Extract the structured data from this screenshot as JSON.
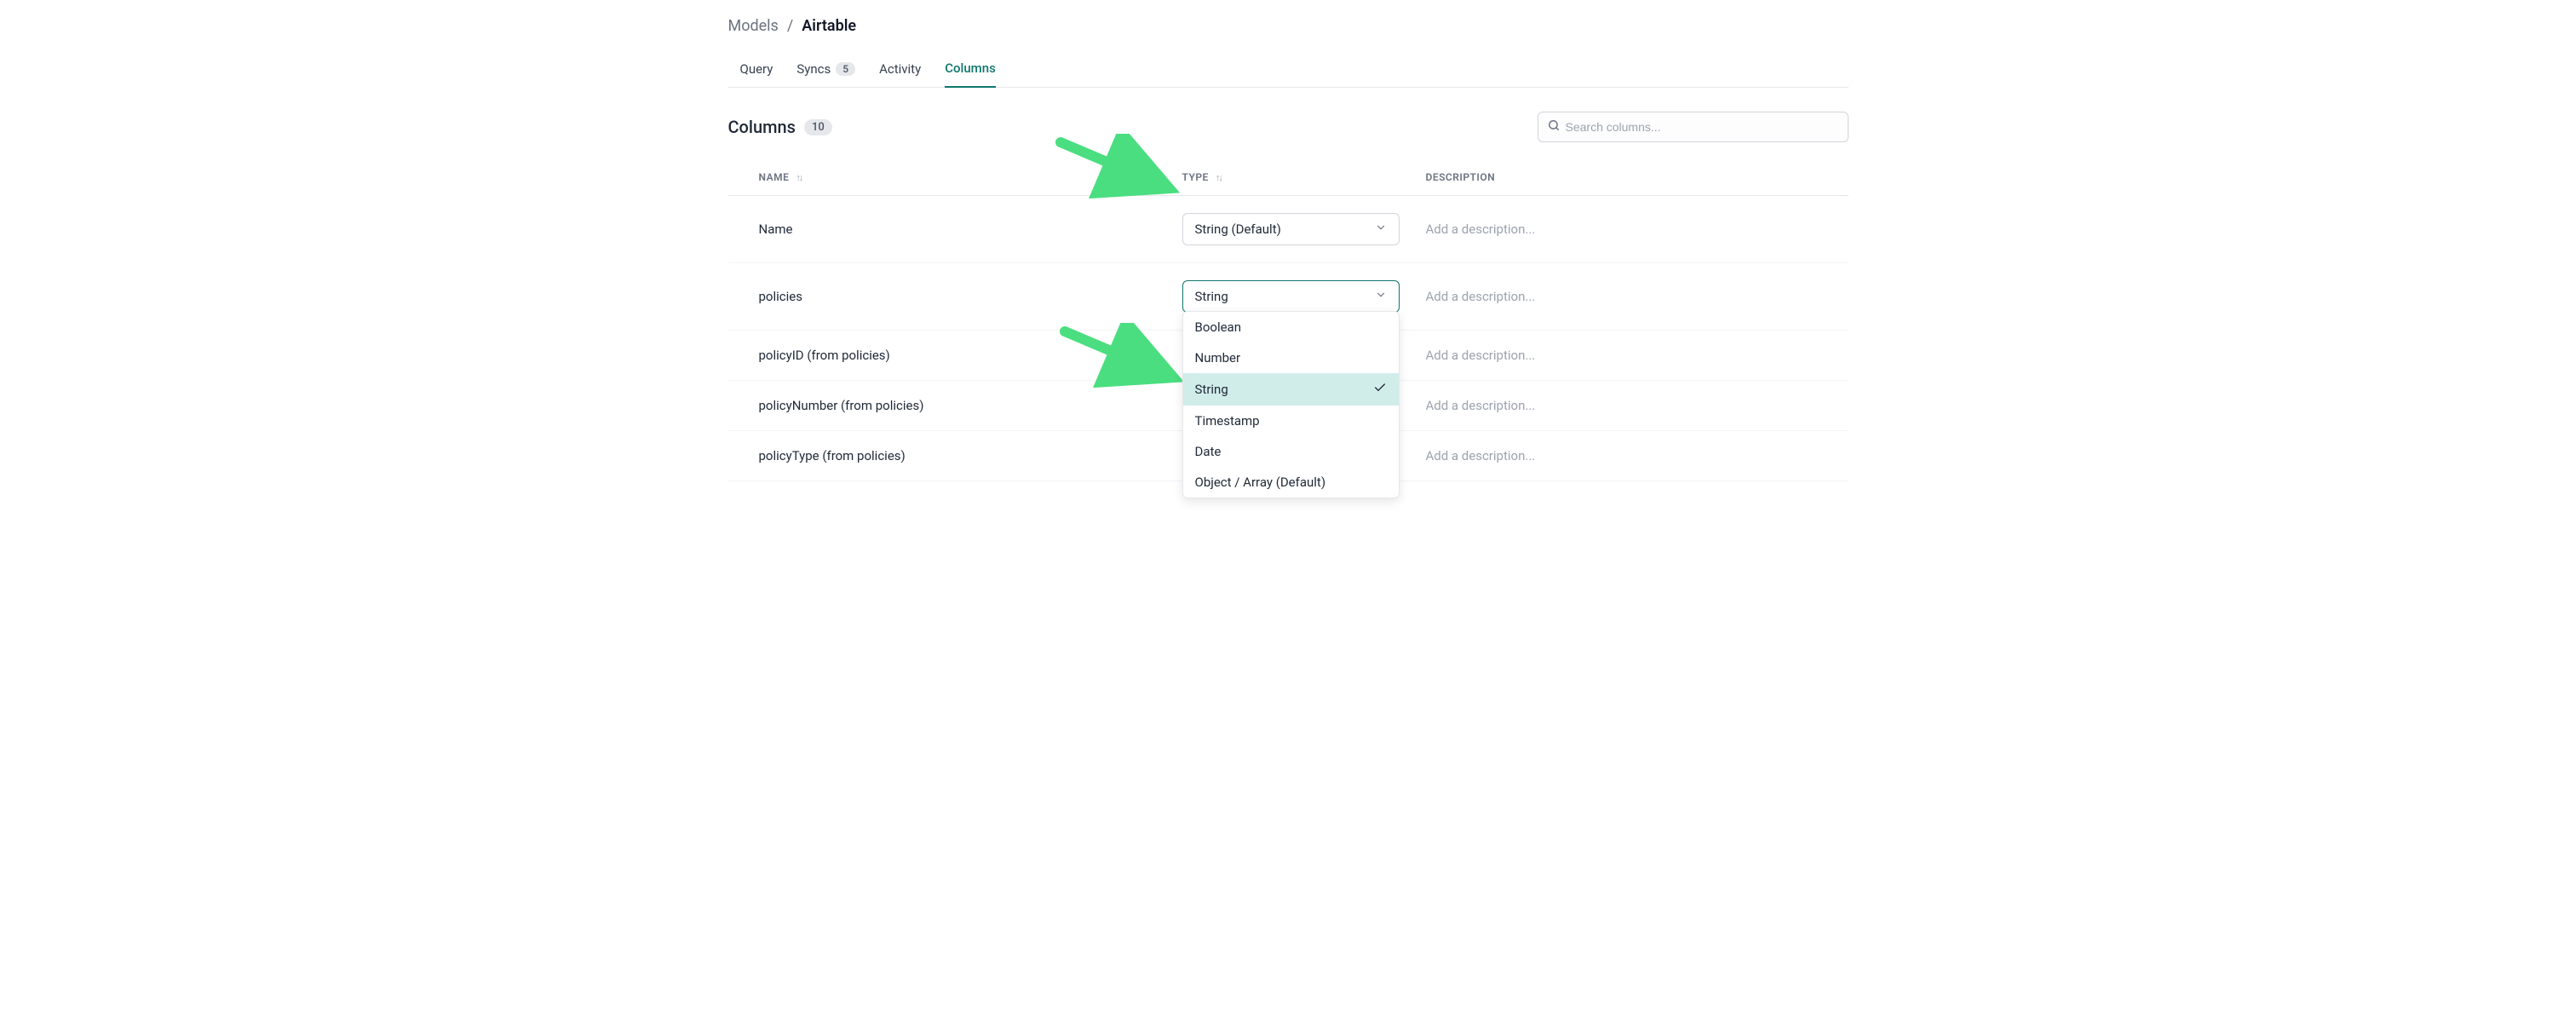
{
  "breadcrumb": {
    "parent": "Models",
    "separator": "/",
    "current": "Airtable"
  },
  "tabs": {
    "query": "Query",
    "syncs": "Syncs",
    "syncs_count": "5",
    "activity": "Activity",
    "columns": "Columns"
  },
  "columns_section": {
    "title": "Columns",
    "count": "10"
  },
  "search": {
    "placeholder": "Search columns..."
  },
  "table_headers": {
    "name": "NAME",
    "type": "TYPE",
    "description": "DESCRIPTION"
  },
  "rows": [
    {
      "name": "Name",
      "type": "String (Default)",
      "description_placeholder": "Add a description...",
      "open": false
    },
    {
      "name": "policies",
      "type": "String",
      "description_placeholder": "Add a description...",
      "open": true
    },
    {
      "name": "policyID (from policies)",
      "type": "",
      "description_placeholder": "Add a description...",
      "open": false
    },
    {
      "name": "policyNumber (from policies)",
      "type": "",
      "description_placeholder": "Add a description...",
      "open": false
    },
    {
      "name": "policyType (from policies)",
      "type": "",
      "description_placeholder": "Add a description...",
      "open": false
    }
  ],
  "dropdown_options": [
    {
      "label": "Boolean",
      "selected": false
    },
    {
      "label": "Number",
      "selected": false
    },
    {
      "label": "String",
      "selected": true
    },
    {
      "label": "Timestamp",
      "selected": false
    },
    {
      "label": "Date",
      "selected": false
    },
    {
      "label": "Object / Array (Default)",
      "selected": false
    }
  ]
}
